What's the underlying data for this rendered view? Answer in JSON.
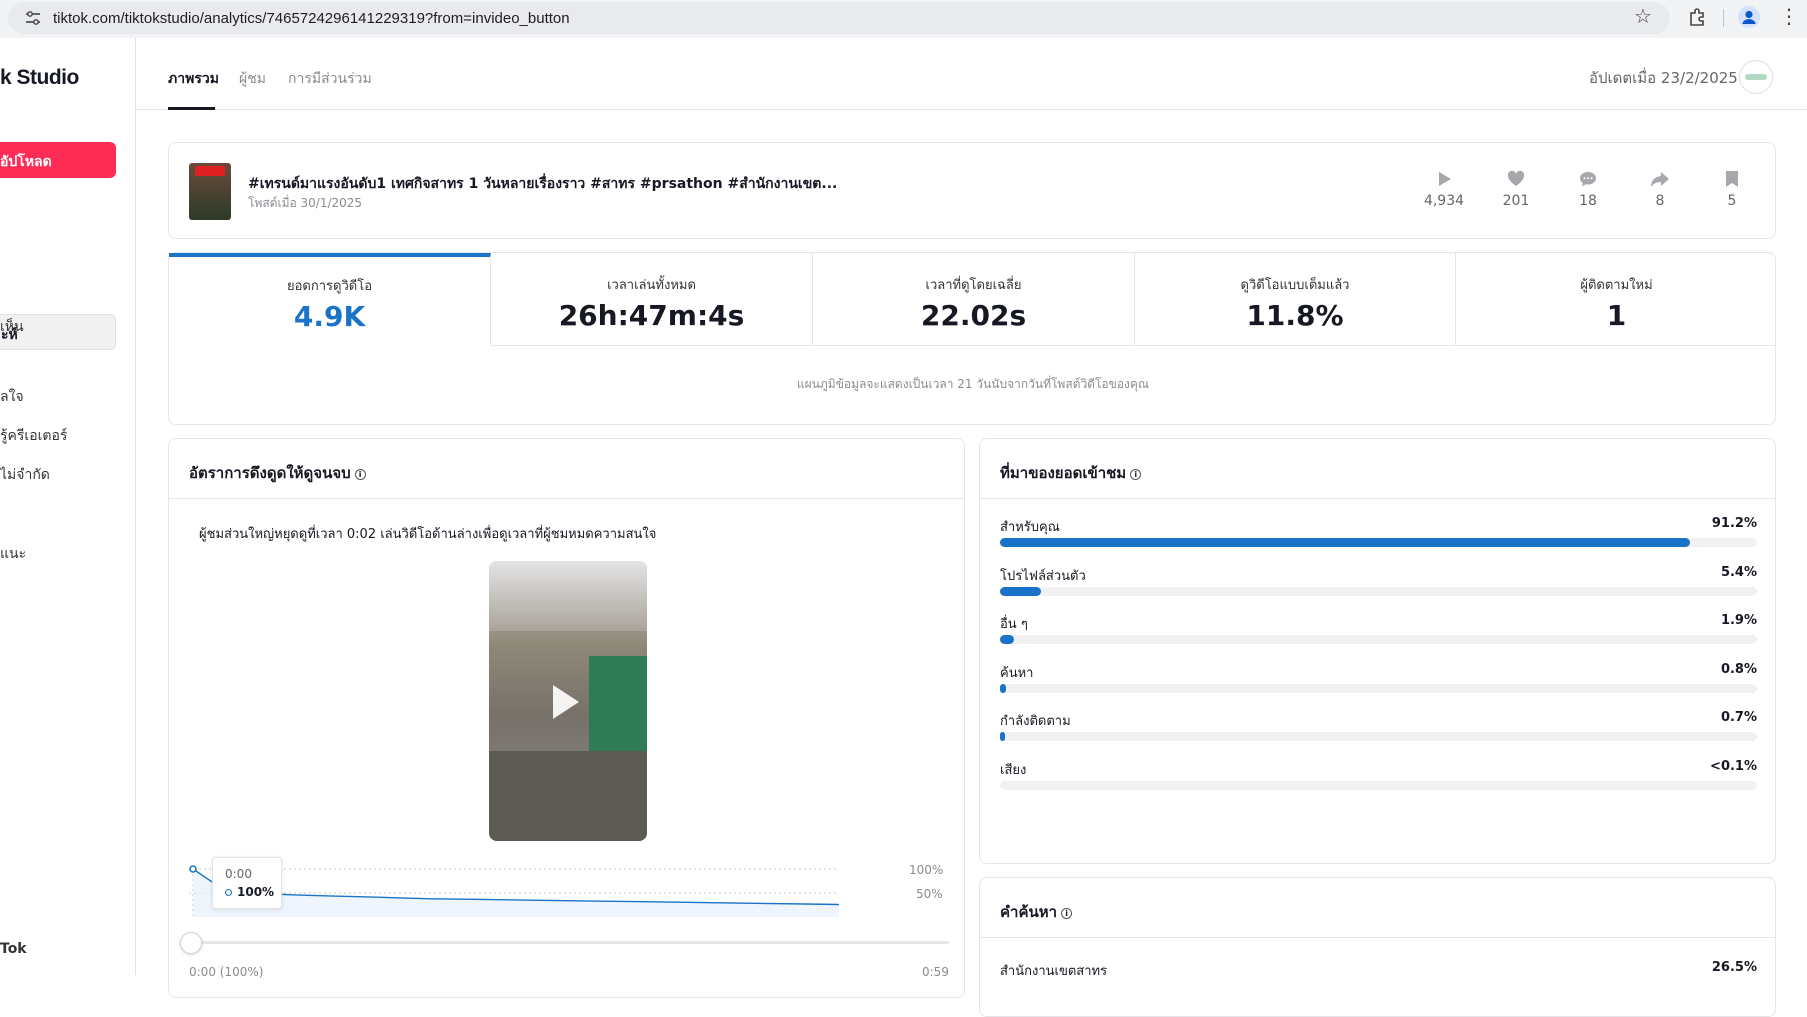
{
  "browser": {
    "url": "tiktok.com/tiktokstudio/analytics/7465724296141229319?from=invideo_button"
  },
  "sidebar": {
    "logo": "k Studio",
    "upload_label": "อัปโหลด",
    "active_item": "ะห์",
    "items": [
      "เห็น",
      "ลใจ",
      "รู้ครีเอเตอร์",
      "ไม่จำกัด",
      "แนะ"
    ],
    "footer": "Tok"
  },
  "header": {
    "tabs": [
      "ภาพรวม",
      "ผู้ชม",
      "การมีส่วนร่วม"
    ],
    "updated": "อัปเดตเมื่อ 23/2/2025"
  },
  "video": {
    "title": "#เทรนด์มาแรงอันดับ1 เทศกิจสาทร 1 วันหลายเรื่องราว #สาทร #prsathon #สำนักงานเขต...",
    "posted": "โพสต์เมื่อ 30/1/2025",
    "thumb_text": "มก.!!!",
    "stats": [
      {
        "icon": "play-icon",
        "value": "4,934"
      },
      {
        "icon": "heart-icon",
        "value": "201"
      },
      {
        "icon": "comment-icon",
        "value": "18"
      },
      {
        "icon": "share-icon",
        "value": "8"
      },
      {
        "icon": "bookmark-icon",
        "value": "5"
      }
    ]
  },
  "kpis": [
    {
      "label": "ยอดการดูวิดีโอ",
      "value": "4.9K"
    },
    {
      "label": "เวลาเล่นทั้งหมด",
      "value": "26h:47m:4s"
    },
    {
      "label": "เวลาที่ดูโดยเฉลี่ย",
      "value": "22.02s"
    },
    {
      "label": "ดูวิดีโอแบบเต็มแล้ว",
      "value": "11.8%"
    },
    {
      "label": "ผู้ติดตามใหม่",
      "value": "1"
    }
  ],
  "kpi_note": "แผนภูมิข้อมูลจะแสดงเป็นเวลา 21 วันนับจากวันที่โพสต์วิดีโอของคุณ",
  "retention": {
    "title": "อัตราการดึงดูดให้ดูจนจบ",
    "subtitle": "ผู้ชมส่วนใหญ่หยุดดูที่เวลา 0:02 เล่นวิดีโอด้านล่างเพื่อดูเวลาที่ผู้ชมหมดความสนใจ",
    "tooltip_time": "0:00",
    "tooltip_value": "100%",
    "y_labels": [
      "100%",
      "50%"
    ],
    "x_start": "0:00 (100%)",
    "x_end": "0:59",
    "curve_pct": [
      100,
      52,
      49,
      46,
      44,
      42,
      40,
      38,
      37,
      36,
      35,
      34,
      33,
      32,
      31,
      30,
      29,
      28,
      27,
      26
    ],
    "accent": "#1a73c8"
  },
  "traffic": {
    "title": "ที่มาของยอดเข้าชม",
    "rows": [
      {
        "label": "สำหรับคุณ",
        "value": "91.2%",
        "pct": 91.2
      },
      {
        "label": "โปรไฟล์ส่วนตัว",
        "value": "5.4%",
        "pct": 5.4
      },
      {
        "label": "อื่น ๆ",
        "value": "1.9%",
        "pct": 1.9
      },
      {
        "label": "ค้นหา",
        "value": "0.8%",
        "pct": 0.8
      },
      {
        "label": "กำลังติดตาม",
        "value": "0.7%",
        "pct": 0.7
      },
      {
        "label": "เสียง",
        "value": "<0.1%",
        "pct": 0
      }
    ],
    "bar_color": "#1a73c8"
  },
  "search_terms": {
    "title": "คำค้นหา",
    "rows": [
      {
        "label": "สำนักงานเขตสาทร",
        "value": "26.5%"
      }
    ]
  }
}
